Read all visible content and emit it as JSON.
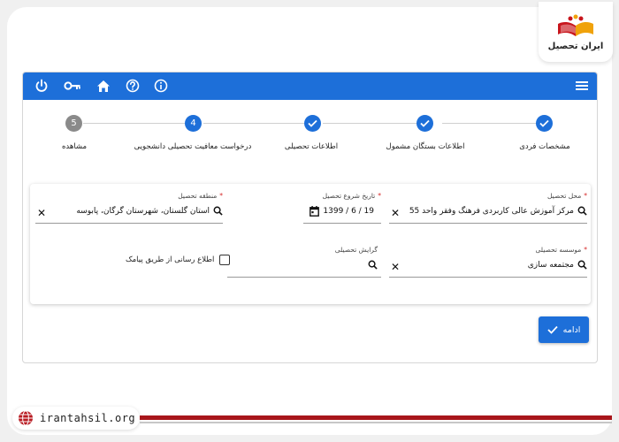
{
  "brand": {
    "logo_text": "ایران تحصیل",
    "website": "irantahsil.org"
  },
  "topbar": {
    "icons": [
      "power-icon",
      "key-icon",
      "home-icon",
      "help-icon",
      "info-icon",
      "menu-icon"
    ]
  },
  "stepper": {
    "steps": [
      {
        "label": "مشخصات فردی",
        "state": "done"
      },
      {
        "label": "اطلاعات بستگان مشمول",
        "state": "done"
      },
      {
        "label": "اطلاعات تحصیلی",
        "state": "done"
      },
      {
        "label": "درخواست معافیت تحصیلی دانشجویی",
        "state": "active",
        "number": "4"
      },
      {
        "label": "مشاهده",
        "state": "pending",
        "number": "5"
      }
    ]
  },
  "form": {
    "study_place": {
      "label": "محل تحصیل",
      "required": "*",
      "value": "مرکز آموزش عالی کاربردی فرهنگ وفقر واحد 55"
    },
    "start_date": {
      "label": "تاریخ شروع تحصیل",
      "required": "*",
      "value": "1399 / 6 / 19"
    },
    "study_region": {
      "label": "منطقه تحصیل",
      "required": "*",
      "value": "استان گلستان، شهرستان گرگان، پابوسه"
    },
    "institution": {
      "label": "موسسه تحصیلی",
      "required": "*",
      "value": "مجتمعه سازی"
    },
    "major_branch": {
      "label": "گرایش تحصیلی",
      "value": ""
    },
    "sms_notify": {
      "label": "اطلاع رسانی از طریق پیامک",
      "checked": false
    }
  },
  "actions": {
    "continue_label": "ادامه"
  },
  "colors": {
    "primary": "#1d6fd9",
    "pending": "#8a8a8a",
    "required": "#d62828",
    "brand_red": "#a8161b"
  }
}
